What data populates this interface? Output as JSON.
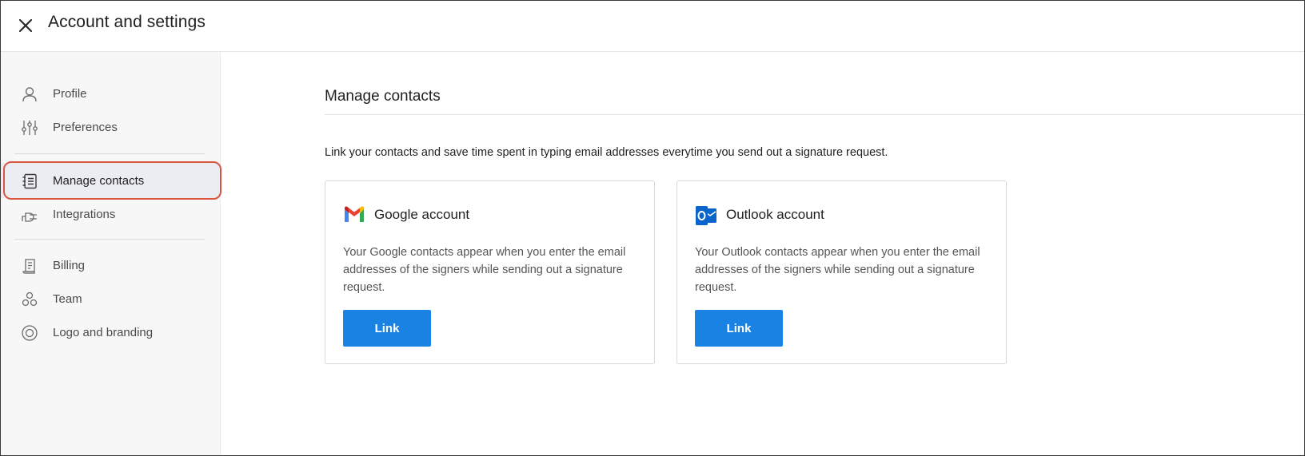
{
  "header": {
    "title": "Account and settings",
    "close_icon": "close-icon"
  },
  "sidebar": {
    "items": [
      {
        "label": "Profile",
        "icon": "user-icon"
      },
      {
        "label": "Preferences",
        "icon": "sliders-icon"
      },
      {
        "label": "Manage contacts",
        "icon": "contacts-book-icon",
        "active": true
      },
      {
        "label": "Integrations",
        "icon": "plug-icon"
      },
      {
        "label": "Billing",
        "icon": "receipt-icon"
      },
      {
        "label": "Team",
        "icon": "team-icon"
      },
      {
        "label": "Logo and branding",
        "icon": "target-icon"
      }
    ]
  },
  "main": {
    "title": "Manage contacts",
    "description": "Link your contacts and save time spent in typing email addresses everytime you send out a signature request.",
    "cards": [
      {
        "title": "Google account",
        "icon": "gmail-icon",
        "text": "Your Google contacts appear when you enter the email addresses of the signers while sending out a signature request.",
        "button": "Link"
      },
      {
        "title": "Outlook account",
        "icon": "outlook-icon",
        "text": "Your Outlook contacts appear when you enter the email addresses of the signers while sending out a signature request.",
        "button": "Link"
      }
    ]
  },
  "colors": {
    "accent": "#1a82e2",
    "highlight_outline": "#d9553f",
    "sidebar_bg": "#f7f7f7",
    "active_item_bg": "#ecedf3"
  }
}
